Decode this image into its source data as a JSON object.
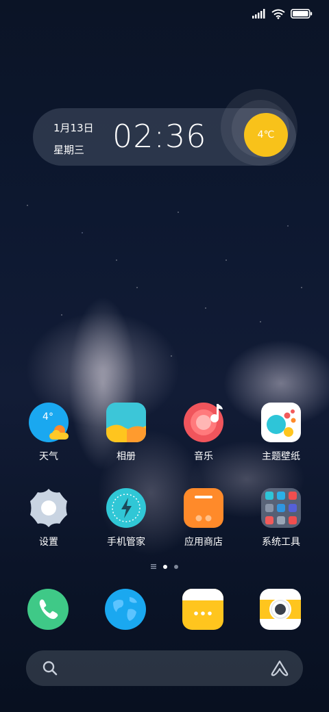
{
  "status_bar": {
    "signal_icon": "signal-icon",
    "wifi_icon": "wifi-icon",
    "battery_icon": "battery-icon"
  },
  "clock_widget": {
    "date": "1月13日",
    "weekday": "星期三",
    "time": "02:36",
    "temperature": "4℃",
    "accent": "#f8c21a"
  },
  "apps_row1": [
    {
      "label": "天气",
      "icon": "weather-icon",
      "temp": "4°"
    },
    {
      "label": "相册",
      "icon": "gallery-icon"
    },
    {
      "label": "音乐",
      "icon": "music-icon"
    },
    {
      "label": "主题壁纸",
      "icon": "themes-icon"
    }
  ],
  "apps_row2": [
    {
      "label": "设置",
      "icon": "settings-icon"
    },
    {
      "label": "手机管家",
      "icon": "security-icon"
    },
    {
      "label": "应用商店",
      "icon": "app-store-icon"
    },
    {
      "label": "系统工具",
      "icon": "tools-folder-icon"
    }
  ],
  "page_indicator": {
    "current": 1,
    "pages": 2
  },
  "dock": [
    {
      "icon": "phone-icon"
    },
    {
      "icon": "browser-icon"
    },
    {
      "icon": "messages-icon"
    },
    {
      "icon": "camera-icon"
    }
  ],
  "search_bar": {
    "search_icon": "search-icon",
    "assistant_icon": "assistant-icon"
  }
}
